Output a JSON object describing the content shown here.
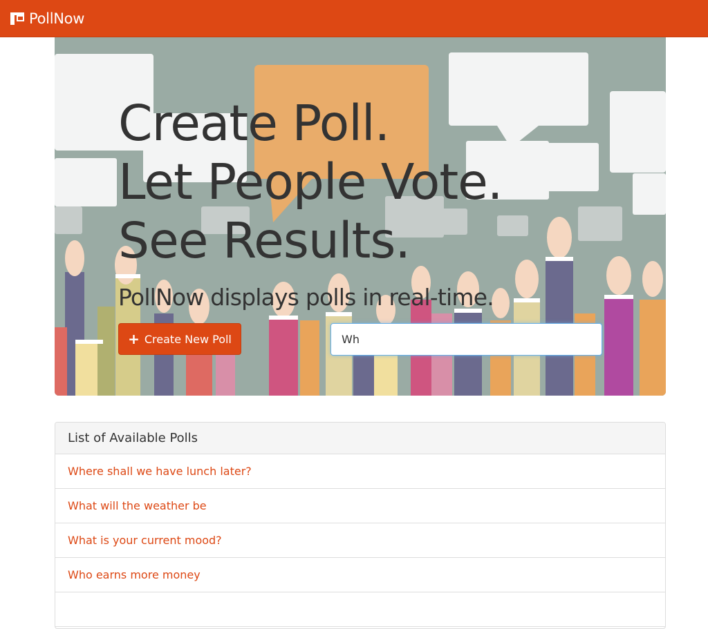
{
  "navbar": {
    "brand": "PollNow",
    "icon": "poll-logo-icon"
  },
  "hero": {
    "headline": [
      "Create Poll.",
      "Let People Vote.",
      "See Results."
    ],
    "lead": "PollNow displays polls in real-time.",
    "create_button": "Create New Poll",
    "create_icon": "plus-icon",
    "search_value": "Wh"
  },
  "polls": {
    "heading": "List of Available Polls",
    "items": [
      "Where shall we have lunch later?",
      "What will the weather be",
      "What is your current mood?",
      "Who earns more money"
    ]
  },
  "colors": {
    "accent": "#dd4814",
    "hero_bg": "#9aaba4"
  }
}
